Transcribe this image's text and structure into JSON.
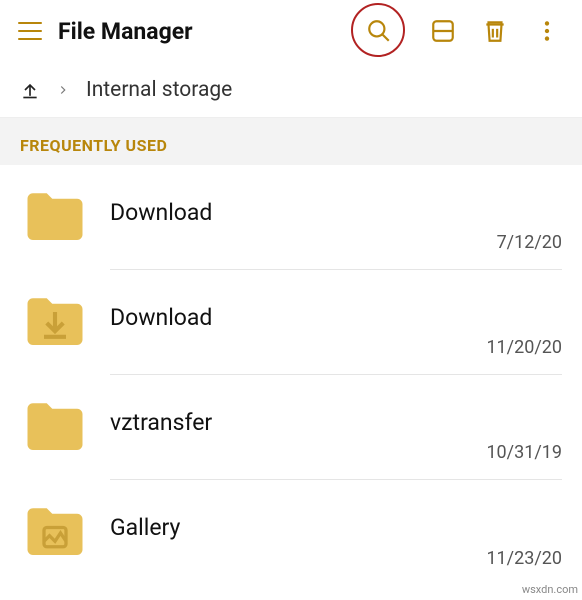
{
  "colors": {
    "accent": "#b8860b",
    "highlight_ring": "#b22222"
  },
  "topbar": {
    "title": "File Manager"
  },
  "breadcrumb": {
    "location": "Internal storage"
  },
  "section": {
    "header": "FREQUENTLY USED"
  },
  "items": [
    {
      "icon": "folder",
      "name": "Download",
      "date": "7/12/20"
    },
    {
      "icon": "folder-download",
      "name": "Download",
      "date": "11/20/20"
    },
    {
      "icon": "folder",
      "name": "vztransfer",
      "date": "10/31/19"
    },
    {
      "icon": "folder-image",
      "name": "Gallery",
      "date": "11/23/20"
    }
  ],
  "watermark": "wsxdn.com"
}
